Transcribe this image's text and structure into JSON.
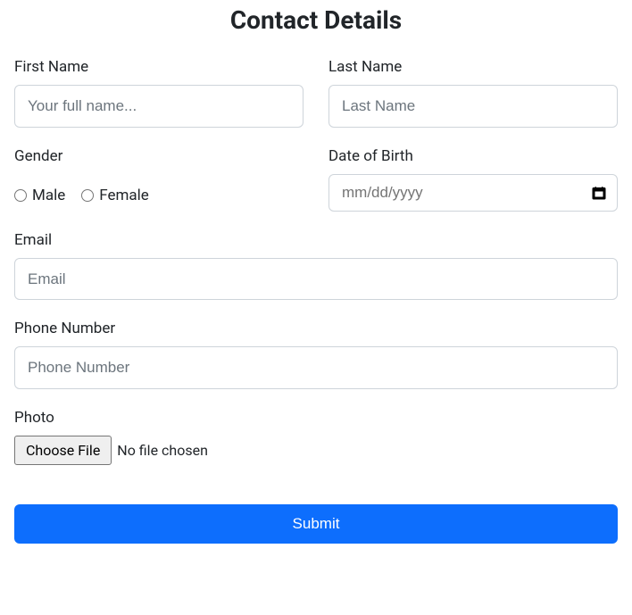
{
  "title": "Contact Details",
  "fields": {
    "firstName": {
      "label": "First Name",
      "placeholder": "Your full name..."
    },
    "lastName": {
      "label": "Last Name",
      "placeholder": "Last Name"
    },
    "gender": {
      "label": "Gender",
      "options": {
        "male": "Male",
        "female": "Female"
      }
    },
    "dob": {
      "label": "Date of Birth",
      "placeholder": "mm/dd/yyyy"
    },
    "email": {
      "label": "Email",
      "placeholder": "Email"
    },
    "phone": {
      "label": "Phone Number",
      "placeholder": "Phone Number"
    },
    "photo": {
      "label": "Photo",
      "button": "Choose File",
      "status": "No file chosen"
    }
  },
  "submit": "Submit"
}
